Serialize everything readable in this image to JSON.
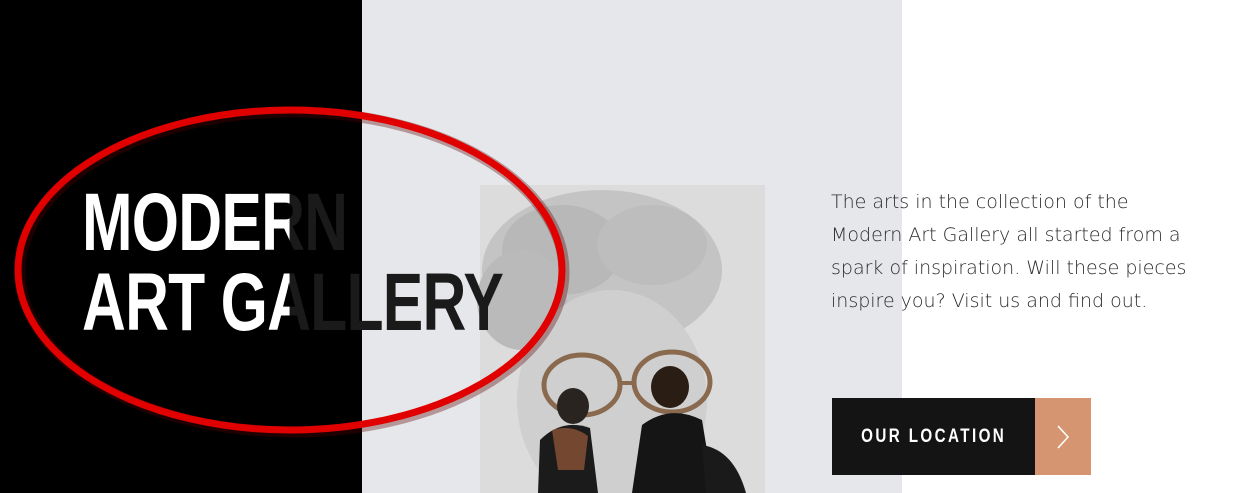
{
  "hero": {
    "title_line1": "MODERN",
    "title_line2": "ART GALLERY",
    "description": "The arts in the collection of the Modern Art Gallery all started from a spark of inspiration. Will these pieces inspire you? Visit us and find out.",
    "cta_label": "OUR LOCATION",
    "cta_icon": "chevron-right-icon"
  },
  "colors": {
    "dark": "#000000",
    "button": "#141414",
    "accent": "#d49570",
    "annotation": "#e00000"
  }
}
